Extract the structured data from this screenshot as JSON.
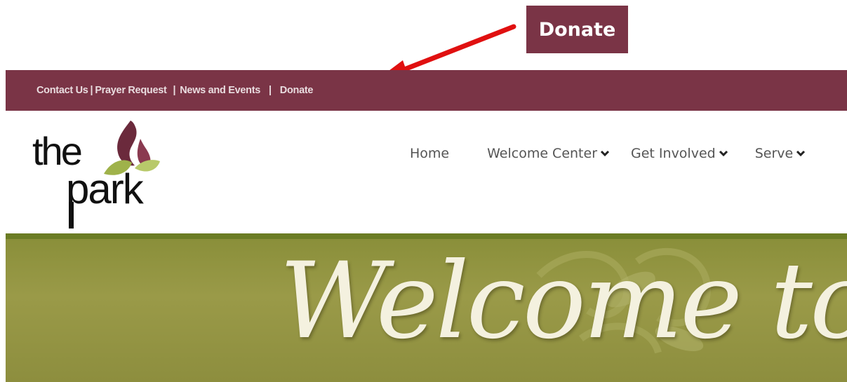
{
  "callout": {
    "label": "Donate"
  },
  "topbar": {
    "links": [
      "Contact Us",
      "Prayer Request",
      "News and Events",
      "Donate"
    ],
    "separator": "|"
  },
  "logo": {
    "word1": "the",
    "word2": "park"
  },
  "nav": {
    "items": [
      {
        "label": "Home",
        "has_dropdown": false
      },
      {
        "label": "Welcome Center",
        "has_dropdown": true
      },
      {
        "label": "Get Involved",
        "has_dropdown": true
      },
      {
        "label": "Serve",
        "has_dropdown": true
      }
    ]
  },
  "hero": {
    "headline": "Welcome to"
  },
  "colors": {
    "brand_maroon": "#7a3446",
    "hero_olive": "#8a8f3a",
    "arrow_red": "#e01010"
  }
}
